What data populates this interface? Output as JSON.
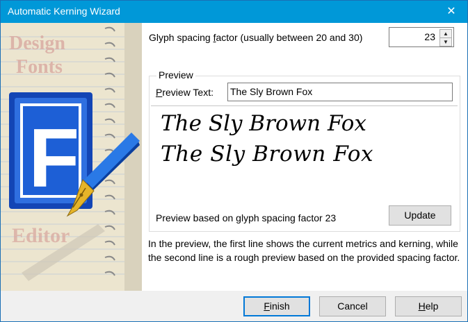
{
  "window": {
    "title": "Automatic Kerning Wizard",
    "close_glyph": "✕"
  },
  "art": {
    "top_text_1": "Design",
    "top_text_2": "Fonts",
    "bottom_text": "Editor",
    "logo_letter": "F"
  },
  "glyph_spacing": {
    "label_pre": "Glyph spacing ",
    "label_accel": "f",
    "label_post": "actor (usually between 20 and 30)",
    "value": "23",
    "up_glyph": "▲",
    "down_glyph": "▼"
  },
  "preview": {
    "legend": "Preview",
    "text_label_accel": "P",
    "text_label_rest": "review Text:",
    "text_value": "The Sly Brown Fox",
    "line1": "The Sly Brown Fox",
    "line2": "The Sly Brown Fox",
    "based_on": "Preview based on glyph spacing factor 23",
    "update_label": "Update"
  },
  "info_text": "In the preview, the first line shows the current metrics and kerning, while the second line is a rough preview based on the provided spacing factor.",
  "footer": {
    "finish_accel": "F",
    "finish_rest": "inish",
    "cancel_label": "Cancel",
    "help_accel": "H",
    "help_rest": "elp"
  }
}
